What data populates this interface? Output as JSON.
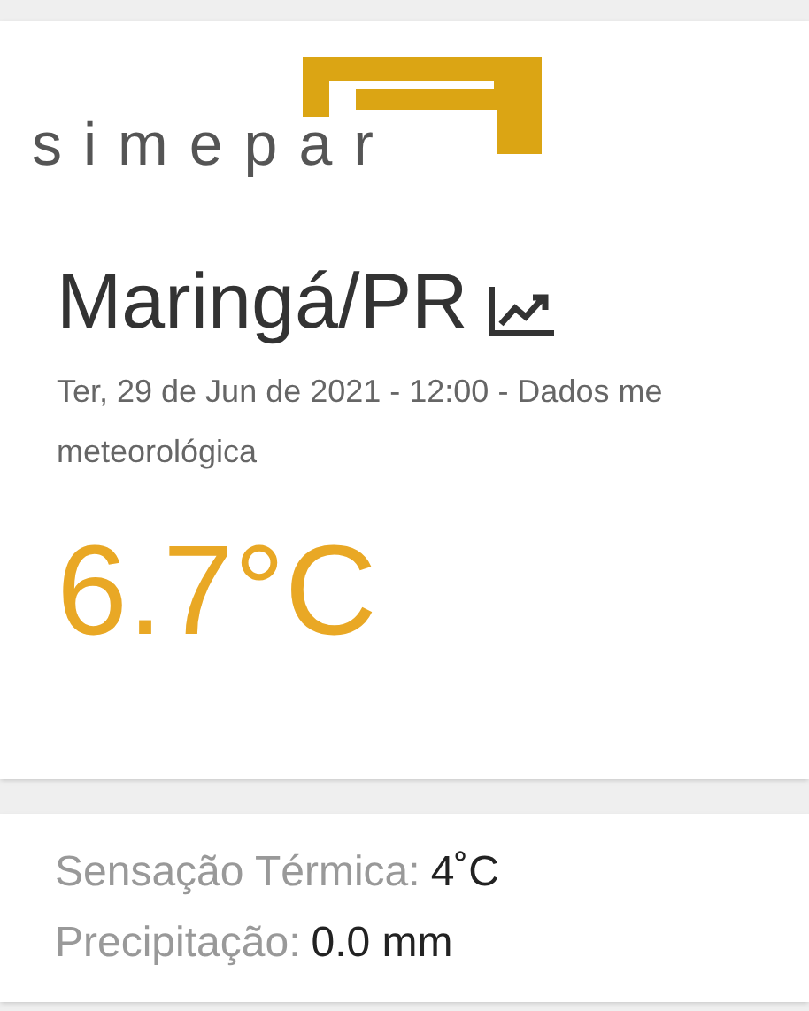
{
  "logo": {
    "text": "simepar"
  },
  "station": {
    "city": "Maringá/PR",
    "subtitle_lines": [
      "Ter, 29 de Jun de 2021 - 12:00 - Dados me",
      "meteorológica"
    ],
    "temperature": "6.7°C"
  },
  "details": [
    {
      "label": "Sensação Térmica:",
      "value": "4˚C"
    },
    {
      "label": "Precipitação:",
      "value": "0.0 mm"
    }
  ]
}
